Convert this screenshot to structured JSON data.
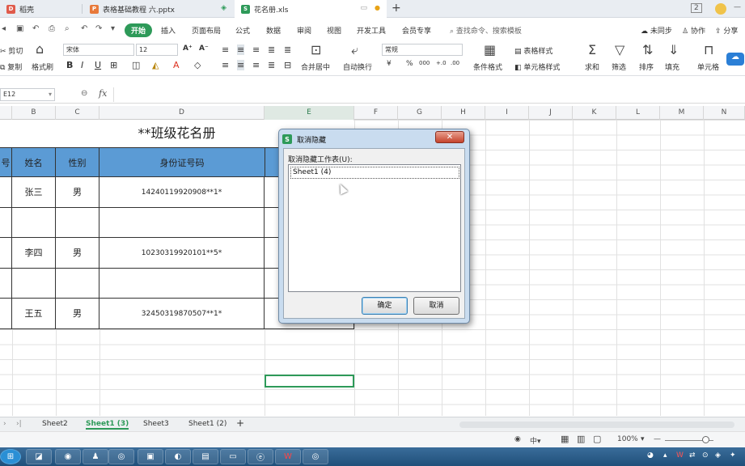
{
  "tabs": [
    {
      "label": "稻壳",
      "icon_color": "#e05b4b",
      "icon_glyph": "D"
    },
    {
      "label": "表格基础教程 六.pptx",
      "icon_color": "#e8793a",
      "icon_glyph": "P"
    },
    {
      "label": "花名册.xls",
      "icon_color": "#2e9a59",
      "icon_glyph": "S"
    }
  ],
  "window_badge": "2",
  "menu": {
    "items": [
      "开始",
      "插入",
      "页面布局",
      "公式",
      "数据",
      "审阅",
      "视图",
      "开发工具",
      "会员专享"
    ],
    "search_placeholder": "查找命令、搜索模板",
    "right_links": [
      "未同步",
      "协作",
      "分享"
    ]
  },
  "ribbon": {
    "cut": "剪切",
    "copy": "复制",
    "format_painter": "格式刷",
    "font_name": "宋体",
    "font_size": "12",
    "merge_center": "合并居中",
    "wrap_text": "自动换行",
    "number_format": "常规",
    "currency": "¥",
    "percent": "%",
    "thousands": "000",
    "dec_inc": "+.0",
    "dec_dec": ".00",
    "cond_format": "条件格式",
    "table_style": "表格样式",
    "cell_style": "单元格样式",
    "sum": "求和",
    "filter": "筛选",
    "sort": "排序",
    "fill": "填充",
    "cell": "单元格"
  },
  "formula_bar": {
    "name_box": "E12",
    "fx": "fx",
    "value": ""
  },
  "columns": [
    "B",
    "C",
    "D",
    "E",
    "F",
    "G",
    "H",
    "I",
    "J",
    "K",
    "L",
    "M",
    "N"
  ],
  "sheet": {
    "title": "**班级花名册",
    "headers": {
      "num": "号",
      "name": "姓名",
      "gender": "性别",
      "id": "身份证号码"
    },
    "rows": [
      {
        "name": "张三",
        "gender": "男",
        "id": "14240119920908**1*"
      },
      {
        "name": "",
        "gender": "",
        "id": ""
      },
      {
        "name": "李四",
        "gender": "男",
        "id": "10230319920101**5*"
      },
      {
        "name": "",
        "gender": "",
        "id": ""
      },
      {
        "name": "王五",
        "gender": "男",
        "id": "32450319870507**1*"
      }
    ]
  },
  "sheet_tabs": [
    "Sheet2",
    "Sheet1 (3)",
    "Sheet3",
    "Sheet1 (2)"
  ],
  "active_sheet": "Sheet1 (3)",
  "status": {
    "zoom": "100%"
  },
  "dialog": {
    "title": "取消隐藏",
    "label": "取消隐藏工作表(U):",
    "list_items": [
      "Sheet1 (4)"
    ],
    "ok": "确定",
    "cancel": "取消",
    "close": "✕"
  },
  "colors": {
    "accent": "#2e9a59",
    "header_fill": "#5b9bd5"
  }
}
